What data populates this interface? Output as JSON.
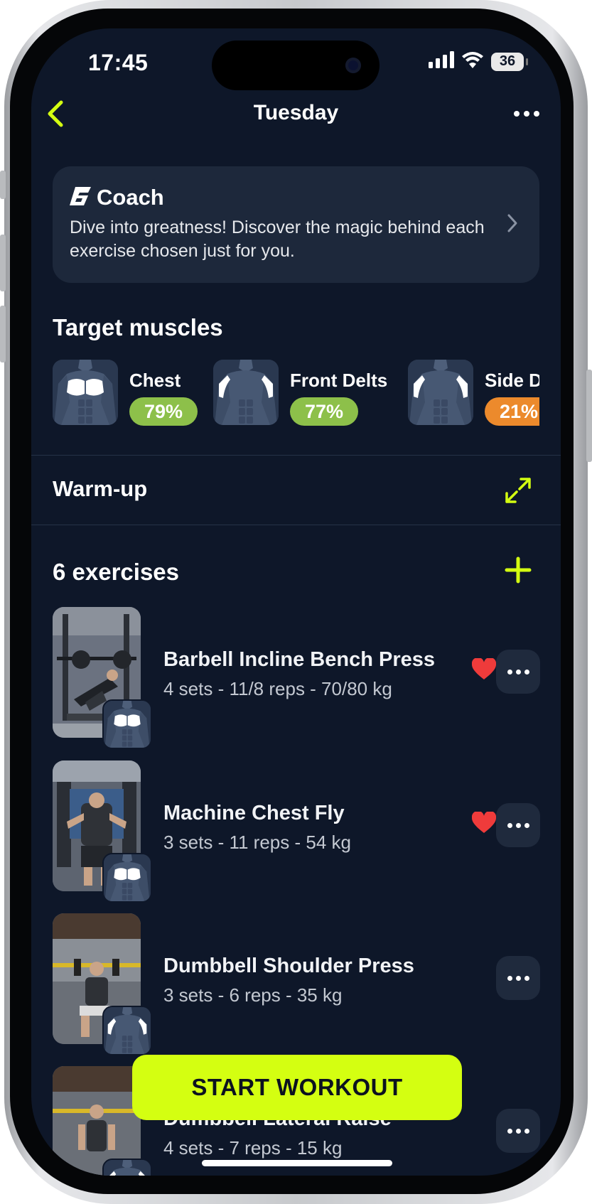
{
  "status_bar": {
    "time": "17:45",
    "battery": "36"
  },
  "nav": {
    "title": "Tuesday"
  },
  "coach": {
    "title": "Coach",
    "text": "Dive into greatness! Discover the magic behind each exercise chosen just for you."
  },
  "target_muscles": {
    "title": "Target muscles",
    "items": [
      {
        "name": "Chest",
        "percent": "79%",
        "color": "#8dc04a"
      },
      {
        "name": "Front Delts",
        "percent": "77%",
        "color": "#8dc04a"
      },
      {
        "name": "Side D",
        "percent": "21%",
        "color": "#ec8a2c"
      }
    ]
  },
  "warmup": {
    "label": "Warm-up"
  },
  "exercises": {
    "count_label": "6 exercises",
    "items": [
      {
        "name": "Barbell Incline Bench Press",
        "detail": "4 sets - 11/8 reps - 70/80 kg",
        "favorite": true
      },
      {
        "name": "Machine Chest Fly",
        "detail": "3 sets - 11 reps - 54 kg",
        "favorite": true
      },
      {
        "name": "Dumbbell Shoulder Press",
        "detail": "3 sets - 6 reps - 35 kg",
        "favorite": false
      },
      {
        "name": "Dumbbell Lateral Raise",
        "detail": "4 sets - 7 reps - 15 kg",
        "favorite": false
      }
    ]
  },
  "start_button": {
    "label": "START WORKOUT"
  },
  "colors": {
    "accent": "#d4ff11",
    "background": "#0e1729",
    "card": "#1d283b",
    "heart": "#ef3b3b"
  }
}
